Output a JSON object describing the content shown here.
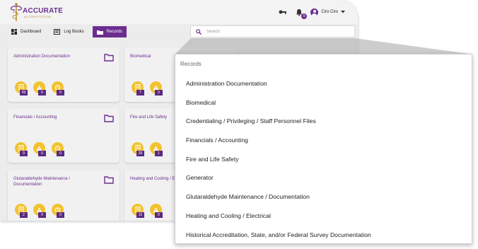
{
  "brand": {
    "name": "ACCURATE",
    "tagline": "ACCREDITATION",
    "color": "#6b2d90",
    "accent": "#f2c230"
  },
  "header": {
    "icons": [
      "key-icon",
      "bell-icon"
    ],
    "notification_count": "0",
    "user_name": "Ciro Ciro"
  },
  "tabs": [
    {
      "label": "Dashboard",
      "icon": "dashboard-icon"
    },
    {
      "label": "Log Books",
      "icon": "logbook-icon"
    },
    {
      "label": "Records",
      "icon": "folder-icon",
      "active": true
    }
  ],
  "search": {
    "placeholder": "Search"
  },
  "cards": [
    {
      "title": "Administration Documentation",
      "counts": [
        "49",
        "0",
        "0"
      ]
    },
    {
      "title": "Biomedical",
      "counts": [
        "7",
        "0",
        ""
      ]
    },
    {
      "title": "Financials / Accounting",
      "counts": [
        "9",
        "0",
        "0"
      ]
    },
    {
      "title": "Fire and Life Safety",
      "counts": [
        "26",
        "1",
        ""
      ]
    },
    {
      "title": "Glutaraldehyde Maintenance / Documentation",
      "counts": [
        "2",
        "0",
        "0"
      ]
    },
    {
      "title": "Heating and Cooling / E",
      "counts": [
        "12",
        "0",
        ""
      ]
    }
  ],
  "dropdown": {
    "header": "Records",
    "items": [
      "Administration Documentation",
      "Biomedical",
      "Credentialing / Privileging / Staff Personnel Files",
      "Financials / Accounting",
      "Fire and Life Safety",
      "Generator",
      "Glutaraldehyde Maintenance / Documentation",
      "Heating and Cooling / Electrical",
      "Historical Accreditation, State, and/or Federal Survey Documentation"
    ]
  }
}
